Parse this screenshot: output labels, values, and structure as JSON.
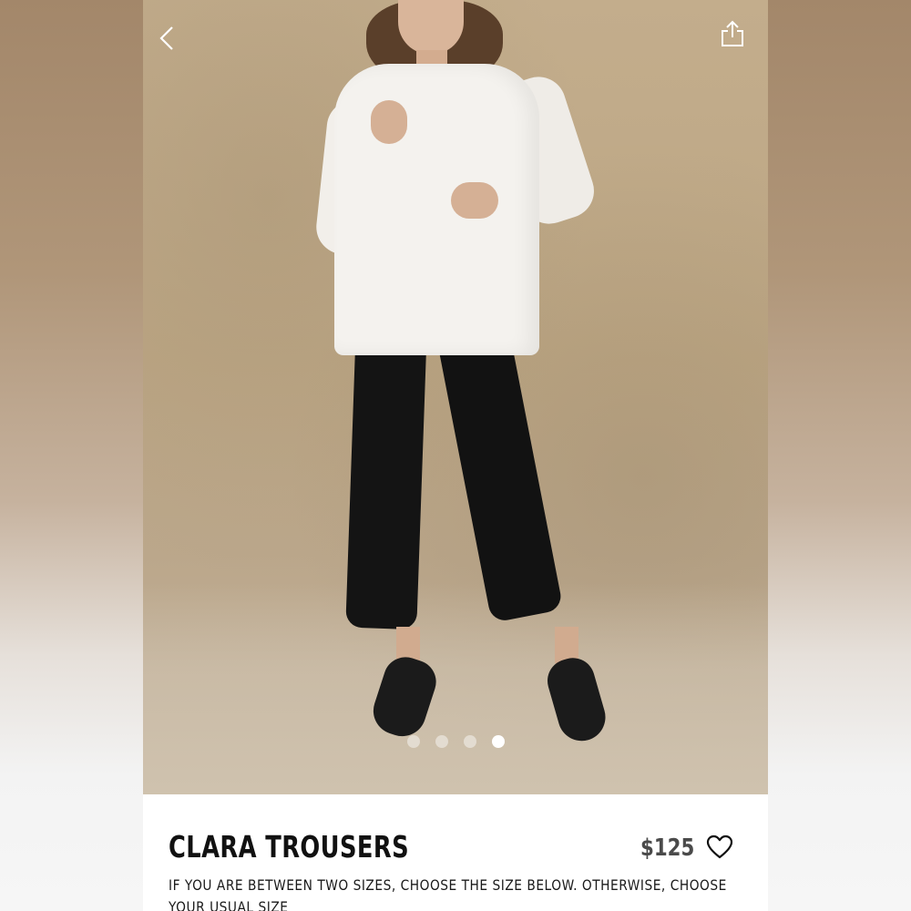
{
  "product": {
    "title": "CLARA TROUSERS",
    "price": "$125",
    "size_note": "IF YOU ARE BETWEEN TWO SIZES, CHOOSE THE SIZE BELOW. OTHERWISE, CHOOSE YOUR USUAL SIZE"
  },
  "gallery": {
    "image_count": 4,
    "active_index": 4
  },
  "icons": {
    "back": "chevron-left-icon",
    "share": "share-icon",
    "favorite": "heart-icon"
  },
  "colors": {
    "background_photo": "#bca684",
    "title_text": "#111111",
    "price_text": "#4a4a4a"
  }
}
